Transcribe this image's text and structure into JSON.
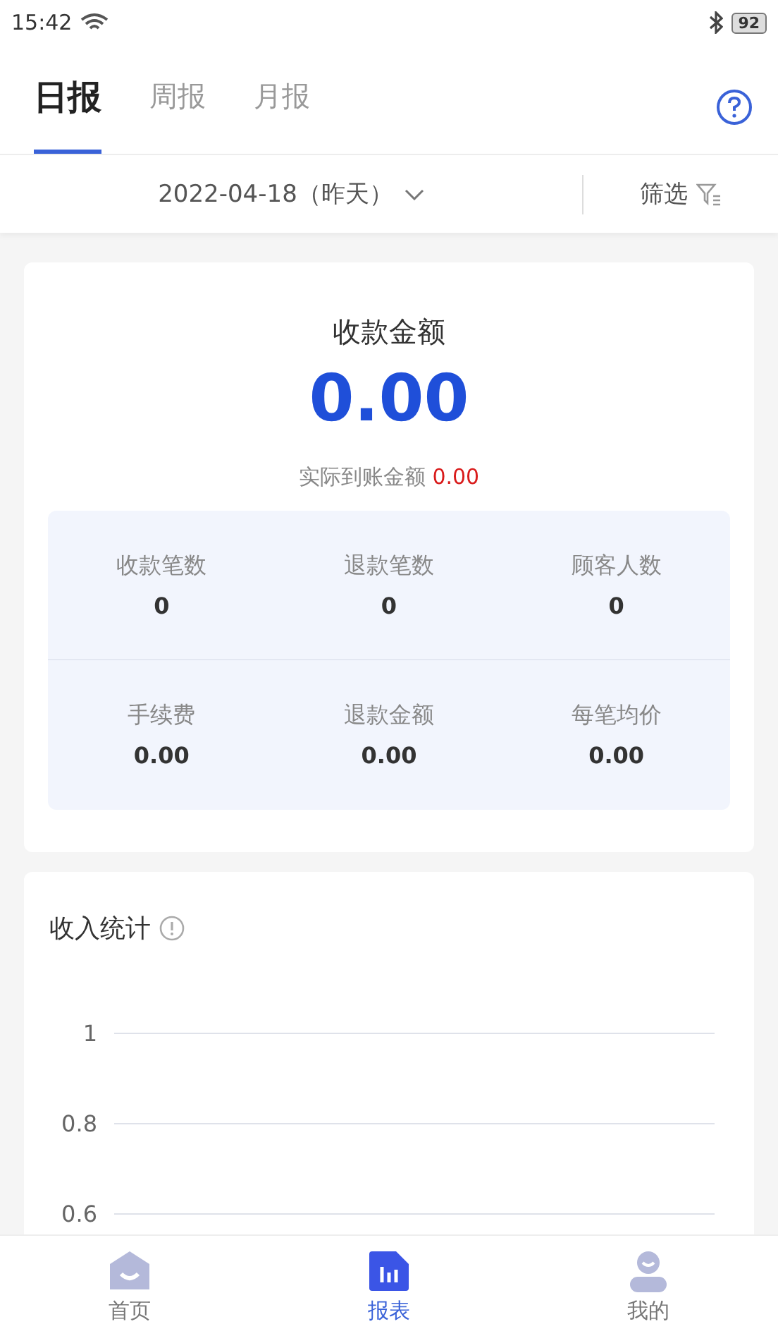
{
  "status_bar": {
    "time": "15:42",
    "battery": "92"
  },
  "tabs": [
    {
      "label": "日报",
      "selected": true
    },
    {
      "label": "周报",
      "selected": false
    },
    {
      "label": "月报",
      "selected": false
    }
  ],
  "filter_bar": {
    "date": "2022-04-18（昨天）",
    "filter": "筛选"
  },
  "summary": {
    "title": "收款金额",
    "amount": "0.00",
    "actual_label": "实际到账金额",
    "actual_value": "0.00",
    "stats": [
      {
        "label": "收款笔数",
        "value": "0"
      },
      {
        "label": "退款笔数",
        "value": "0"
      },
      {
        "label": "顾客人数",
        "value": "0"
      },
      {
        "label": "手续费",
        "value": "0.00"
      },
      {
        "label": "退款金额",
        "value": "0.00"
      },
      {
        "label": "每笔均价",
        "value": "0.00"
      }
    ]
  },
  "income": {
    "title": "收入统计",
    "axis_labels": [
      "1",
      "0.8",
      "0.6"
    ]
  },
  "nav": [
    {
      "label": "首页",
      "kind": "home",
      "selected": false
    },
    {
      "label": "报表",
      "kind": "report",
      "selected": true
    },
    {
      "label": "我的",
      "kind": "profile",
      "selected": false
    }
  ]
}
